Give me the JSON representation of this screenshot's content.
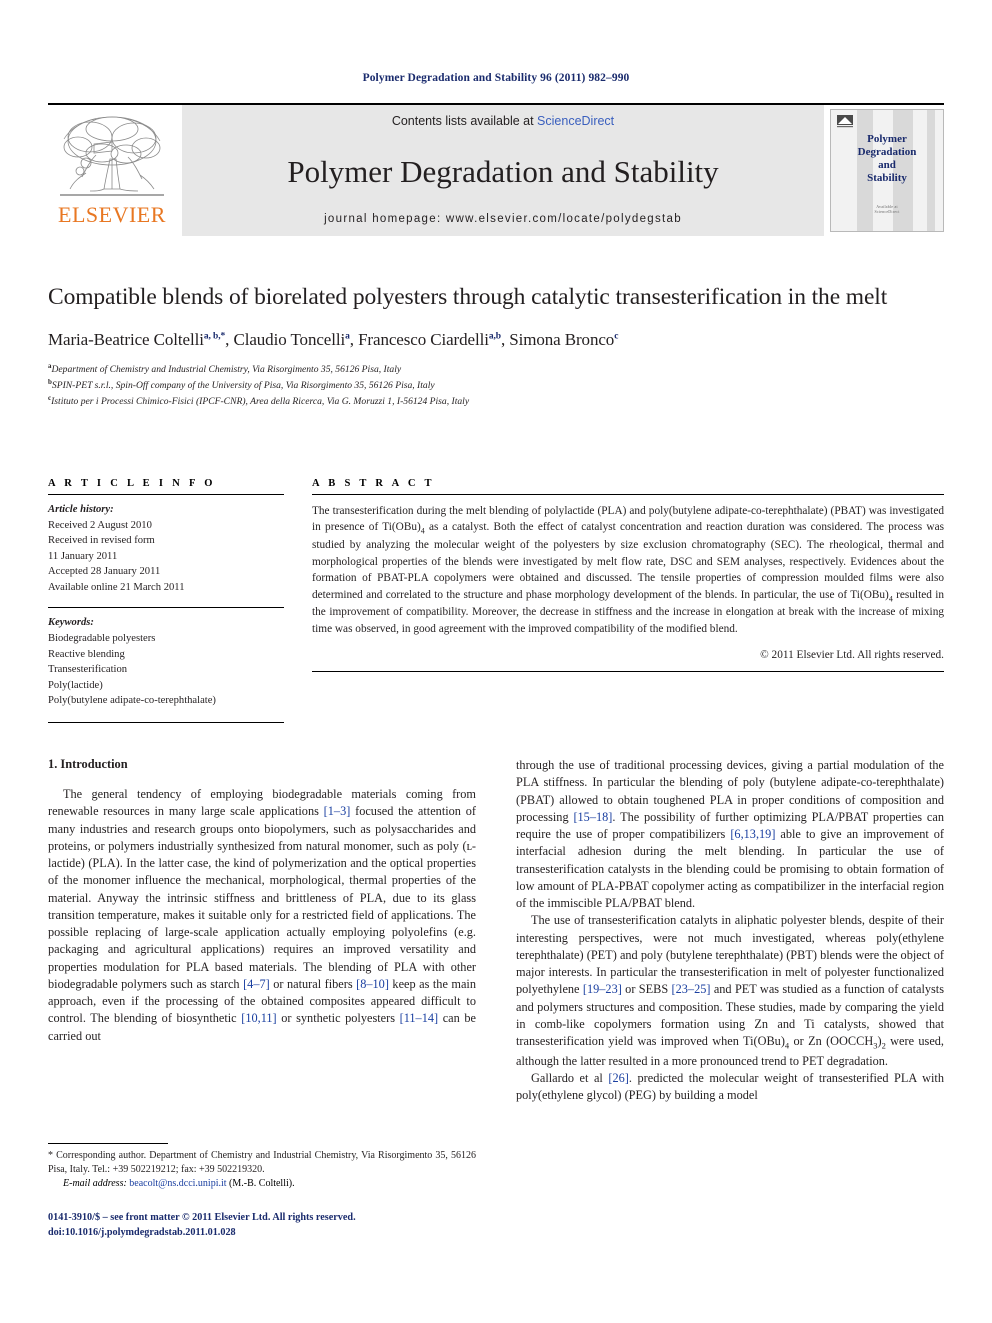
{
  "running_head": "Polymer Degradation and Stability 96 (2011) 982–990",
  "masthead": {
    "publisher_name": "ELSEVIER",
    "contents_prefix": "Contents lists available at ",
    "contents_link": "ScienceDirect",
    "journal_title": "Polymer Degradation and Stability",
    "homepage_line": "journal homepage: www.elsevier.com/locate/polydegstab",
    "cover_title": "Polymer Degradation and Stability",
    "cover_footer": "Available at\nScienceDirect"
  },
  "article": {
    "title": "Compatible blends of biorelated polyesters through catalytic transesterification in the melt",
    "authors": "Maria-Beatrice Coltelli, Claudio Toncelli, Francesco Ciardelli, Simona Bronco",
    "authors_parts": [
      {
        "name": "Maria-Beatrice Coltelli",
        "sup": "a, b,*"
      },
      {
        "name": "Claudio Toncelli",
        "sup": "a"
      },
      {
        "name": "Francesco Ciardelli",
        "sup": "a,b"
      },
      {
        "name": "Simona Bronco",
        "sup": "c"
      }
    ],
    "affiliations": [
      {
        "mark": "a",
        "text": "Department of Chemistry and Industrial Chemistry, Via Risorgimento 35, 56126 Pisa, Italy"
      },
      {
        "mark": "b",
        "text": "SPIN-PET s.r.l., Spin-Off company of the University of Pisa, Via Risorgimento 35, 56126 Pisa, Italy"
      },
      {
        "mark": "c",
        "text": "Istituto per i Processi Chimico-Fisici (IPCF-CNR), Area della Ricerca, Via G. Moruzzi 1, I-56124 Pisa, Italy"
      }
    ]
  },
  "article_info": {
    "heading": "A R T I C L E  I N F O",
    "history_label": "Article history:",
    "history": [
      "Received 2 August 2010",
      "Received in revised form",
      "11 January 2011",
      "Accepted 28 January 2011",
      "Available online 21 March 2011"
    ],
    "keywords_label": "Keywords:",
    "keywords": [
      "Biodegradable polyesters",
      "Reactive blending",
      "Transesterification",
      "Poly(lactide)",
      "Poly(butylene adipate-co-terephthalate)"
    ]
  },
  "abstract": {
    "heading": "A B S T R A C T",
    "paragraph_1": "The transesterification during the melt blending of polylactide (PLA) and poly(butylene adipate-co-terephthalate) (PBAT) was investigated in presence of Ti(OBu)",
    "paragraph_2": " as a catalyst. Both the effect of catalyst concentration and reaction duration was considered. The process was studied by analyzing the molecular weight of the polyesters by size exclusion chromatography (SEC). The rheological, thermal and morphological properties of the blends were investigated by melt flow rate, DSC and SEM analyses, respectively. Evidences about the formation of PBAT-PLA copolymers were obtained and discussed. The tensile properties of compression moulded films were also determined and correlated to the structure and phase morphology development of the blends. In particular, the use of Ti(OBu)",
    "paragraph_3": " resulted in the improvement of compatibility. Moreover, the decrease in stiffness and the increase in elongation at break with the increase of mixing time was observed, in good agreement with the improved compatibility of the modified blend.",
    "sub_1": "4",
    "sub_2": "4",
    "copyright": "© 2011 Elsevier Ltd. All rights reserved."
  },
  "body": {
    "section_heading": "1. Introduction",
    "left_para_1_a": "The general tendency of employing biodegradable materials coming from renewable resources in many large scale applications ",
    "left_ref_1": "[1–3]",
    "left_para_1_b": " focused the attention of many industries and research groups onto biopolymers, such as polysaccharides and proteins, or polymers industrially synthesized from natural monomer, such as poly (ʟ-lactide) (PLA). In the latter case, the kind of polymerization and the optical properties of the monomer influence the mechanical, morphological, thermal properties of the material. Anyway the intrinsic stiffness and brittleness of PLA, due to its glass transition temperature, makes it suitable only for a restricted field of applications. The possible replacing of large-scale application actually employing polyolefins (e.g. packaging and agricultural applications) requires an improved versatility and properties modulation for PLA based materials. The blending of PLA with other biodegradable polymers such as starch ",
    "left_ref_2": "[4–7]",
    "left_para_1_c": " or natural fibers ",
    "left_ref_3": "[8–10]",
    "left_para_1_d": " keep as the main approach, even if the processing of the obtained composites appeared difficult to control. The blending of biosynthetic ",
    "left_ref_4": "[10,11]",
    "left_para_1_e": " or synthetic polyesters ",
    "left_ref_5": "[11–14]",
    "left_para_1_f": " can be carried out",
    "right_para_1_a": "through the use of traditional processing devices, giving a partial modulation of the PLA stiffness. In particular the blending of poly (butylene adipate-co-terephthalate) (PBAT) allowed to obtain toughened PLA in proper conditions of composition and processing ",
    "right_ref_1": "[15–18]",
    "right_para_1_b": ". The possibility of further optimizing PLA/PBAT properties can require the use of proper compatibilizers ",
    "right_ref_2": "[6,13,19]",
    "right_para_1_c": " able to give an improvement of interfacial adhesion during the melt blending. In particular the use of transesterification catalysts in the blending could be promising to obtain formation of low amount of PLA-PBAT copolymer acting as compatibilizer in the interfacial region of the immiscible PLA/PBAT blend.",
    "right_para_2_a": "The use of transesterification catalyts in aliphatic polyester blends, despite of their interesting perspectives, were not much investigated, whereas poly(ethylene terephthalate) (PET) and poly (butylene terephthalate) (PBT) blends were the object of major interests. In particular the transesterification in melt of polyester functionalized polyethylene ",
    "right_ref_3": "[19–23]",
    "right_para_2_b": " or SEBS ",
    "right_ref_4": "[23–25]",
    "right_para_2_c": " and PET was studied as a function of catalysts and polymers structures and composition. These studies, made by comparing the yield in comb-like copolymers formation using Zn and Ti catalysts, showed that transesterification yield was improved when Ti(OBu)",
    "right_sub_1": "4",
    "right_para_2_d": " or Zn (OOCCH",
    "right_sub_2": "3",
    "right_para_2_e": ")",
    "right_sub_3": "2",
    "right_para_2_f": " were used, although the latter resulted in a more pronounced trend to PET degradation.",
    "right_para_3_a": "Gallardo et al ",
    "right_ref_5": "[26]",
    "right_para_3_b": ". predicted the molecular weight of transesterified PLA with poly(ethylene glycol) (PEG) by building a model"
  },
  "footnote": {
    "text": "* Corresponding author. Department of Chemistry and Industrial Chemistry, Via Risorgimento 35, 56126 Pisa, Italy. Tel.: +39 502219212; fax: +39 502219320.",
    "email_label": "E-mail address:",
    "email": "beacolt@ns.dcci.unipi.it",
    "email_owner": "(M.-B. Coltelli)."
  },
  "issn_footer": {
    "line1": "0141-3910/$ – see front matter © 2011 Elsevier Ltd. All rights reserved.",
    "line2": "doi:10.1016/j.polymdegradstab.2011.01.028"
  },
  "colors": {
    "link_blue": "#3a5fbe",
    "ref_blue": "#1a3fa0",
    "navy": "#1a2b6d",
    "elsevier_orange": "#E87722",
    "band_grey": "#e7e7e7"
  }
}
